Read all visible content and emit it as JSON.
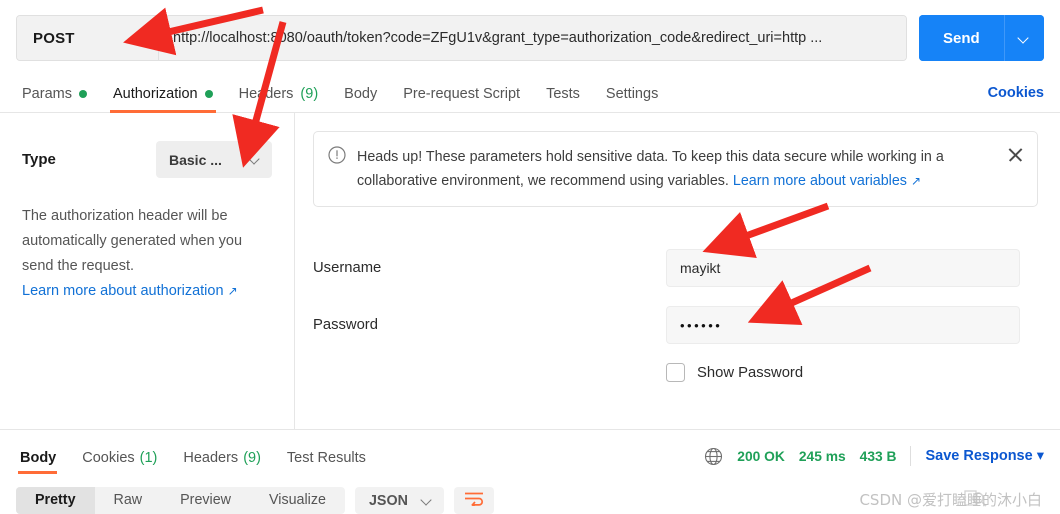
{
  "request": {
    "method": "POST",
    "url": "http://localhost:8080/oauth/token?code=ZFgU1v&grant_type=authorization_code&redirect_uri=http ...",
    "send_label": "Send",
    "tabs": [
      {
        "label": "Params",
        "dot": true,
        "active": false
      },
      {
        "label": "Authorization",
        "dot": true,
        "active": true
      },
      {
        "label": "Headers",
        "count": "(9)",
        "active": false
      },
      {
        "label": "Body",
        "active": false
      },
      {
        "label": "Pre-request Script",
        "active": false
      },
      {
        "label": "Tests",
        "active": false
      },
      {
        "label": "Settings",
        "active": false
      }
    ],
    "cookies_link": "Cookies"
  },
  "auth": {
    "type_label": "Type",
    "type_value": "Basic ...",
    "description": "The authorization header will be automatically generated when you send the request.",
    "learn_more": "Learn more about authorization",
    "banner": {
      "text": "Heads up! These parameters hold sensitive data. To keep this data secure while working in a collaborative environment, we recommend using variables.",
      "link": "Learn more about variables"
    },
    "fields": {
      "username_label": "Username",
      "username_value": "mayikt",
      "password_label": "Password",
      "password_value": "••••••",
      "show_password_label": "Show Password"
    }
  },
  "response": {
    "tabs": [
      {
        "label": "Body",
        "active": true
      },
      {
        "label": "Cookies",
        "count": "(1)",
        "active": false
      },
      {
        "label": "Headers",
        "count": "(9)",
        "active": false
      },
      {
        "label": "Test Results",
        "active": false
      }
    ],
    "status": "200 OK",
    "time": "245 ms",
    "size": "433 B",
    "save_label": "Save Response",
    "format_tabs": [
      {
        "label": "Pretty",
        "active": true
      },
      {
        "label": "Raw",
        "active": false
      },
      {
        "label": "Preview",
        "active": false
      },
      {
        "label": "Visualize",
        "active": false
      }
    ],
    "language": "JSON"
  },
  "watermark": "CSDN @爱打瞌睡的沐小白",
  "colors": {
    "accent_orange": "#ff6c37",
    "link_blue": "#0b57d0",
    "send_blue": "#1683f7",
    "status_green": "#1fa058",
    "annotation_red": "#f02a22"
  }
}
